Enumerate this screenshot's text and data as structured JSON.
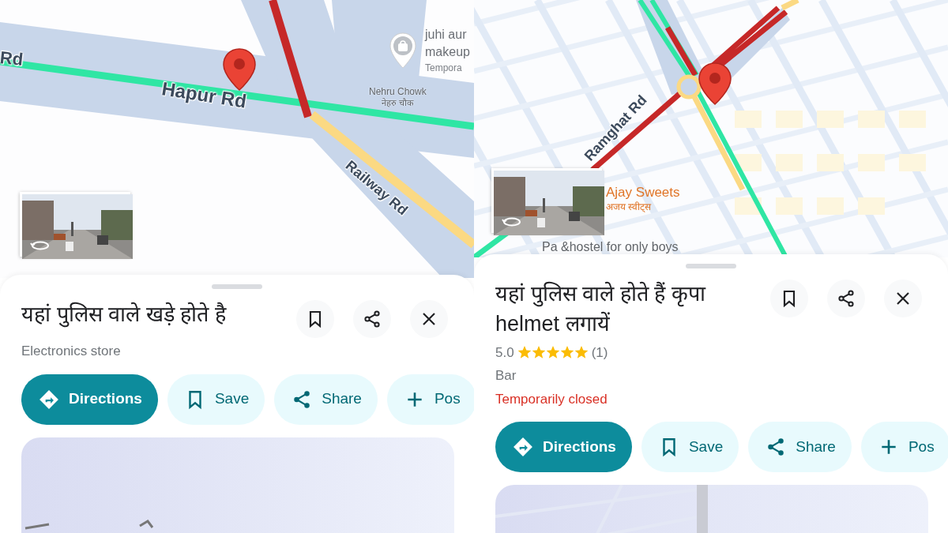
{
  "panels": [
    {
      "map": {
        "labels": [
          {
            "kind": "road",
            "text": "Rd"
          },
          {
            "kind": "road",
            "text": "Hapur Rd"
          },
          {
            "kind": "poi",
            "text": "juhi aur"
          },
          {
            "kind": "poi",
            "text": "makeup"
          },
          {
            "kind": "poi-note",
            "text": "Tempora"
          },
          {
            "kind": "area",
            "text": "Nehru Chowk"
          },
          {
            "kind": "area",
            "text": "नेहरु चौक"
          },
          {
            "kind": "road",
            "text": "Railway Rd"
          }
        ]
      },
      "place": {
        "title": "यहां पुलिस वाले खड़े होते है",
        "category": "Electronics store"
      },
      "actions": [
        {
          "kind": "directions",
          "label": "Directions"
        },
        {
          "kind": "save",
          "label": "Save"
        },
        {
          "kind": "share",
          "label": "Share"
        },
        {
          "kind": "add",
          "label": "Pos"
        }
      ]
    },
    {
      "map": {
        "labels": [
          {
            "kind": "road",
            "text": "Ramghat Rd"
          },
          {
            "kind": "shop",
            "text": "Ajay Sweets"
          },
          {
            "kind": "shop",
            "text": "अजय स्वीट्स"
          },
          {
            "kind": "area",
            "text": "Pa &hostel for only boys"
          }
        ]
      },
      "place": {
        "title": "यहां पुलिस वाले होते हैं कृपा helmet लगायें",
        "rating": "5.0",
        "stars": 5,
        "reviews": "(1)",
        "category": "Bar",
        "status": "Temporarily closed"
      },
      "actions": [
        {
          "kind": "directions",
          "label": "Directions"
        },
        {
          "kind": "save",
          "label": "Save"
        },
        {
          "kind": "share",
          "label": "Share"
        },
        {
          "kind": "add",
          "label": "Pos"
        }
      ]
    }
  ]
}
